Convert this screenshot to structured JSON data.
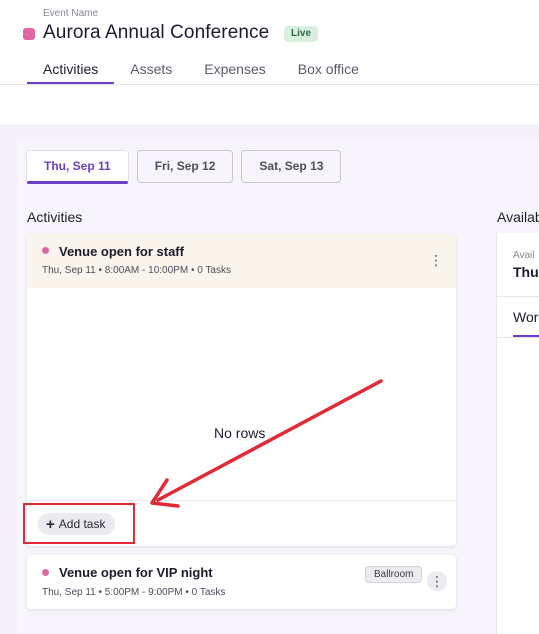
{
  "event": {
    "label": "Event Name",
    "title": "Aurora Annual Conference",
    "status": "Live",
    "color": "#e0679f"
  },
  "tabs": [
    {
      "label": "Activities",
      "active": true
    },
    {
      "label": "Assets",
      "active": false
    },
    {
      "label": "Expenses",
      "active": false
    },
    {
      "label": "Box office",
      "active": false
    }
  ],
  "dates": [
    {
      "label": "Thu, Sep 11",
      "active": true
    },
    {
      "label": "Fri, Sep 12",
      "active": false
    },
    {
      "label": "Sat, Sep 13",
      "active": false
    }
  ],
  "activities": {
    "heading": "Activities",
    "cards": [
      {
        "title": "Venue open for staff",
        "subtitle": "Thu, Sep 11 • 8:00AM - 10:00PM • 0 Tasks",
        "empty_text": "No rows",
        "add_task_label": "Add task"
      },
      {
        "title": "Venue open for VIP night",
        "subtitle": "Thu, Sep 11 • 5:00PM - 9:00PM • 0 Tasks",
        "tag": "Ballroom"
      }
    ]
  },
  "availability": {
    "heading": "Availab",
    "sub_label": "Avail",
    "value": "Thu",
    "tab": "Wor"
  },
  "colors": {
    "accent": "#6b3fc4",
    "annotation": "#e02a35"
  }
}
